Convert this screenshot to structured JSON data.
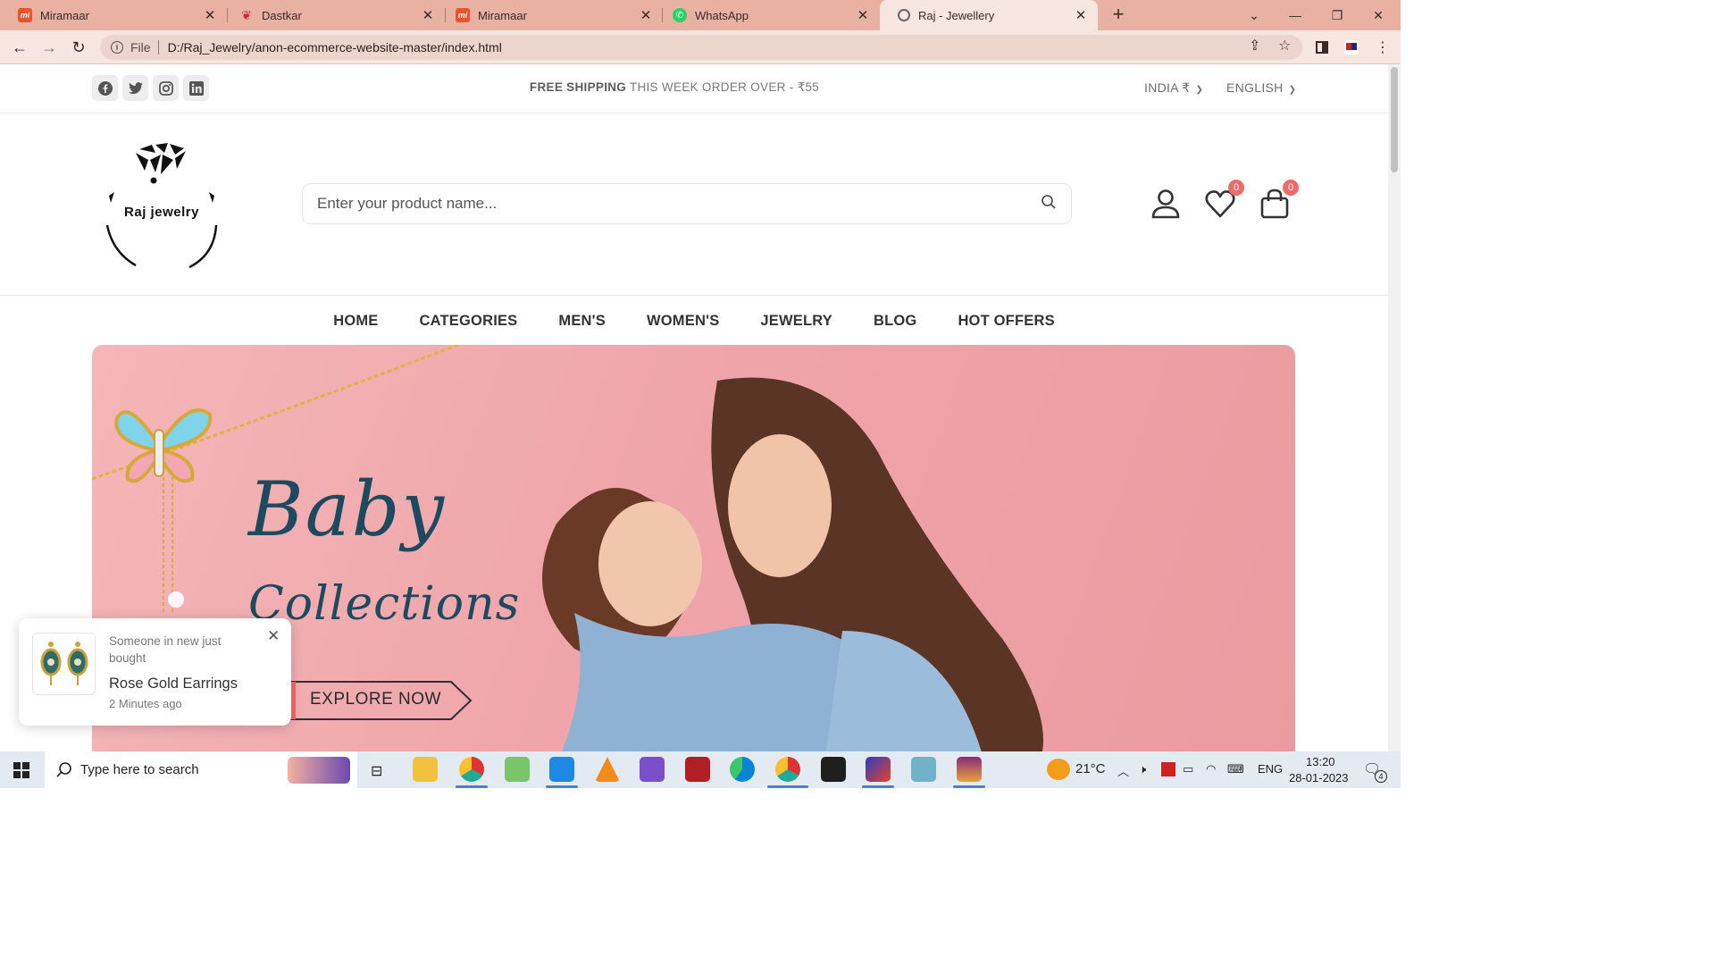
{
  "browser": {
    "tabs": [
      {
        "title": "Miramaar",
        "icon": "miramaar-icon"
      },
      {
        "title": "Dastkar",
        "icon": "dastkar-icon"
      },
      {
        "title": "Miramaar",
        "icon": "miramaar-icon"
      },
      {
        "title": "WhatsApp",
        "icon": "whatsapp-icon"
      },
      {
        "title": "Raj - Jewellery",
        "icon": "globe-icon",
        "active": true
      }
    ],
    "address": {
      "scheme": "File",
      "url": "D:/Raj_Jewelry/anon-ecommerce-website-master/index.html"
    }
  },
  "topbar": {
    "social": [
      "facebook-icon",
      "twitter-icon",
      "instagram-icon",
      "linkedin-icon"
    ],
    "shipping_bold": "FREE SHIPPING",
    "shipping_rest": "THIS WEEK ORDER OVER - ₹55",
    "currency": "INDIA ₹",
    "language": "ENGLISH"
  },
  "header": {
    "logo_text": "Raj jewelry",
    "search_placeholder": "Enter your product name...",
    "wishlist_count": "0",
    "cart_count": "0"
  },
  "menu": [
    "HOME",
    "CATEGORIES",
    "MEN'S",
    "WOMEN'S",
    "JEWELRY",
    "BLOG",
    "HOT OFFERS"
  ],
  "banner": {
    "title_line1": "Baby",
    "title_line2": "Collections",
    "cta": "EXPLORE NOW"
  },
  "toast": {
    "subtitle": "Someone in new just bought",
    "product": "Rose Gold Earrings",
    "time": "2 Minutes ago"
  },
  "taskbar": {
    "search_placeholder": "Type here to search",
    "weather": "21°C",
    "language": "ENG",
    "time": "13:20",
    "date": "28-01-2023",
    "notifications": "4"
  },
  "colors": {
    "tabbar": "#e8b1a2",
    "badge": "#f16a6a",
    "banner": "#efa5aa",
    "banner_text": "#1d4a5e"
  }
}
